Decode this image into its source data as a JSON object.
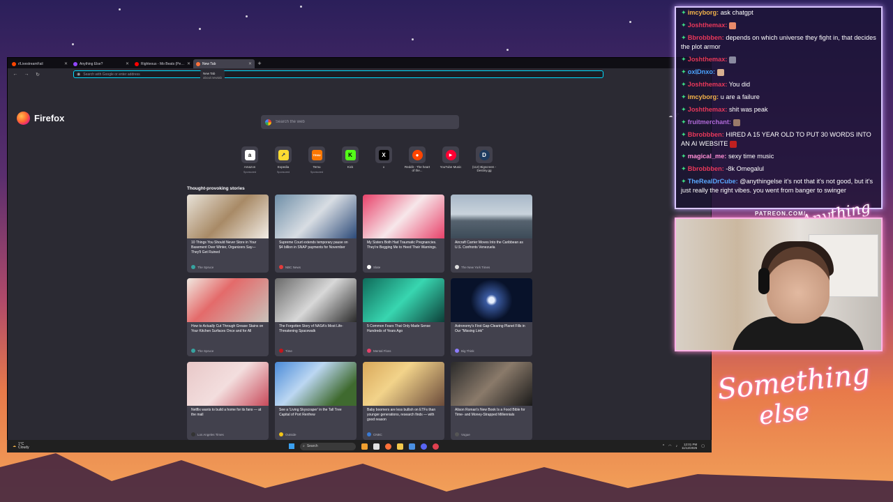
{
  "colors": {
    "firefox_bg": "#2b2a33",
    "card_bg": "#42414d",
    "url_focus": "#00ddff",
    "chat_border": "#d9c6ff",
    "cam_border": "#ffb3e6"
  },
  "browser": {
    "tabs": [
      {
        "title": "r/LivestreamFail",
        "icon": "reddit-icon",
        "color": "#ff4500",
        "active": false
      },
      {
        "title": "Anything Else?",
        "icon": "twitch-icon",
        "color": "#9146ff",
        "active": false
      },
      {
        "title": "Righteous - Mo Beats (Pepe Ar...",
        "icon": "youtube-icon",
        "color": "#ff0000",
        "active": false
      },
      {
        "title": "New Tab",
        "icon": "firefox-icon",
        "color": "#ff7139",
        "active": true
      }
    ],
    "tooltip": {
      "title": "New Tab",
      "subtitle": "about:newtab"
    },
    "url_placeholder": "Search with Google or enter address",
    "brand_name": "Firefox",
    "weather": {
      "temp": "1°",
      "icon": "cloud-icon"
    },
    "search_placeholder": "Search the web",
    "top_sites": [
      {
        "label": "Amazon",
        "sub": "Sponsored",
        "glyph": "a",
        "bg": "#ffffff",
        "fg": "#111111"
      },
      {
        "label": "Expedia",
        "sub": "Sponsored",
        "glyph": "↗",
        "bg": "#fddb32",
        "fg": "#1b2b5a"
      },
      {
        "label": "Temu",
        "sub": "Sponsored",
        "glyph": "TEMU",
        "bg": "#fb7701",
        "fg": "#ffffff"
      },
      {
        "label": "Kick",
        "sub": "",
        "glyph": "K",
        "bg": "#53fc18",
        "fg": "#000000"
      },
      {
        "label": "x",
        "sub": "",
        "glyph": "X",
        "bg": "#000000",
        "fg": "#ffffff"
      },
      {
        "label": "Reddit - The heart of the...",
        "sub": "",
        "glyph": "●",
        "bg": "#ff4500",
        "fg": "#ffffff"
      },
      {
        "label": "YouTube Music",
        "sub": "",
        "glyph": "▶",
        "bg": "#ff0033",
        "fg": "#ffffff"
      },
      {
        "label": "(112) Bigscreen - Destiny.gg",
        "sub": "",
        "glyph": "D",
        "bg": "#1d3b5e",
        "fg": "#ffffff"
      }
    ],
    "stories_heading": "Thought-provoking stories",
    "stories": [
      {
        "title": "10 Things You Should Never Store in Your Basement Over Winter, Organizers Say—They'll Get Ruined",
        "source": "The Spruce",
        "img": "linear-gradient(135deg,#e8e2d8,#a88a66 50%,#f2ede6)",
        "dot": "#36a3a0"
      },
      {
        "title": "Supreme Court extends temporary pause on $4 billion in SNAP payments for November",
        "source": "NBC News",
        "img": "linear-gradient(135deg,#6f8fa8,#d8dde3 50%,#2c4a78)",
        "dot": "#e33b3b"
      },
      {
        "title": "My Sisters Both Had Traumatic Pregnancies. They're Begging Me to Heed Their Warnings.",
        "source": "Slate",
        "img": "linear-gradient(135deg,#e8426a,#f7e7ea 50%,#e8426a)",
        "dot": "#ffffff"
      },
      {
        "title": "Aircraft Carrier Moves Into the Caribbean as U.S. Confronts Venezuela",
        "source": "The New York Times",
        "img": "linear-gradient(180deg,#a8b8c8 0%,#c9d3dc 45%,#56636f 60%,#3d4b58 100%)",
        "dot": "#dddddd"
      },
      {
        "title": "How to Actually Cut Through Grease Stains on Your Kitchen Surfaces Once and for All",
        "source": "The Spruce",
        "img": "linear-gradient(135deg,#f0e8e0,#e46a6a 40%,#c9c2ba)",
        "dot": "#36a3a0"
      },
      {
        "title": "The Forgotten Story of NASA's Most Life-Threatening Spacewalk",
        "source": "Time",
        "img": "linear-gradient(135deg,#6a6a6a,#d8d8d8 50%,#2a2a2a)",
        "dot": "#c4161c"
      },
      {
        "title": "5 Common Fears That Only Made Sense Hundreds of Years Ago",
        "source": "Mental Floss",
        "img": "linear-gradient(135deg,#0f6b5a,#38d6b0 50%,#0c3f38)",
        "dot": "#e8426a"
      },
      {
        "title": "Astronomy's First Gap-Clearing Planet Fills in Our \"Missing Link\"",
        "source": "Big Think",
        "img": "radial-gradient(circle at 50% 50%,#e8f0ff 0 6%,#3a5aa0 12%,#08122a 45%)",
        "dot": "#8d7cff"
      },
      {
        "title": "Netflix wants to build a home for its fans — at the mall",
        "source": "Los Angeles Times",
        "img": "linear-gradient(135deg,#e8c8c8,#f3dede 50%,#c84a5a)",
        "dot": "#333333"
      },
      {
        "title": "See a 'Living Skyscraper' in the Tall Tree Capital of Port Renfrew",
        "source": "Outside",
        "img": "linear-gradient(135deg,#4a8ad8,#bcd7f2 40%,#3f6a2f 80%)",
        "dot": "#f2c417"
      },
      {
        "title": "Baby boomers are less bullish on ETFs than younger generations, research finds — with good reason",
        "source": "CNBC",
        "img": "linear-gradient(135deg,#d9a85a,#f2d38a 40%,#6a4a3a)",
        "dot": "#3a7bd5"
      },
      {
        "title": "Alison Roman's New Book Is a Food Bible for Time- and Money-Strapped Millennials",
        "source": "Vogue",
        "img": "linear-gradient(135deg,#2a2a2a,#8a7a6a 50%,#1a1a1a)",
        "dot": "#555555"
      }
    ],
    "row4_colors": [
      "#6a8a5a",
      "#c8c8b8",
      "#5a4a9a",
      "#d8c8b0"
    ]
  },
  "taskbar": {
    "weather_temp": "1°C",
    "weather_desc": "Cloudy",
    "search_label": "Search",
    "time": "12:01 PM",
    "date": "11/12/2025",
    "apps": [
      "#f0a030",
      "#e0e0e0",
      "#ff7139",
      "#f2c94c",
      "#4a90e2",
      "#5865f2",
      "#e04050"
    ]
  },
  "chat": {
    "messages": [
      {
        "user": "imcyborg:",
        "user_color": "#f2b24a",
        "text": "ask chatgpt"
      },
      {
        "user": "Joshthemax:",
        "user_color": "#e8385a",
        "text": "",
        "emote": "#e88a6a"
      },
      {
        "user": "Bbrobbben:",
        "user_color": "#e8385a",
        "text": "depends on which universe they fight in, that decides the plot armor"
      },
      {
        "user": "Joshthemax:",
        "user_color": "#e8385a",
        "text": "",
        "emote": "#8a8aa0"
      },
      {
        "user": "oxIDnxo:",
        "user_color": "#4aa3ff",
        "text": "",
        "emote": "#d8b090"
      },
      {
        "user": "Joshthemax:",
        "user_color": "#e8385a",
        "text": "You did"
      },
      {
        "user": "imcyborg:",
        "user_color": "#f2b24a",
        "text": "u are a failure"
      },
      {
        "user": "Joshthemax:",
        "user_color": "#e8385a",
        "text": "shit was peak"
      },
      {
        "user": "fruitmerchant:",
        "user_color": "#b06ad8",
        "text": "",
        "emote": "#9a7a6a"
      },
      {
        "user": "Bbrobbben:",
        "user_color": "#e8385a",
        "text": "HIRED A 15 YEAR OLD TO PUT 30 WORDS INTO AN AI WEBSITE",
        "emote": "#c02020"
      },
      {
        "user": "magical_me:",
        "user_color": "#ff8fd6",
        "text": "sexy time music"
      },
      {
        "user": "Bbrobbben:",
        "user_color": "#e8385a",
        "text": "-8k Omegalul"
      },
      {
        "user": "TheRealDrCube:",
        "user_color": "#5aa8ff",
        "text": "@anythingelse it's not that it's not good, but it's just really the right vibes. you went from banger to swinger"
      }
    ]
  },
  "overlay": {
    "patreon": "PATREON.COM/",
    "signature_small": "Anything else?",
    "signature_line1": "Something",
    "signature_line2": "else"
  }
}
